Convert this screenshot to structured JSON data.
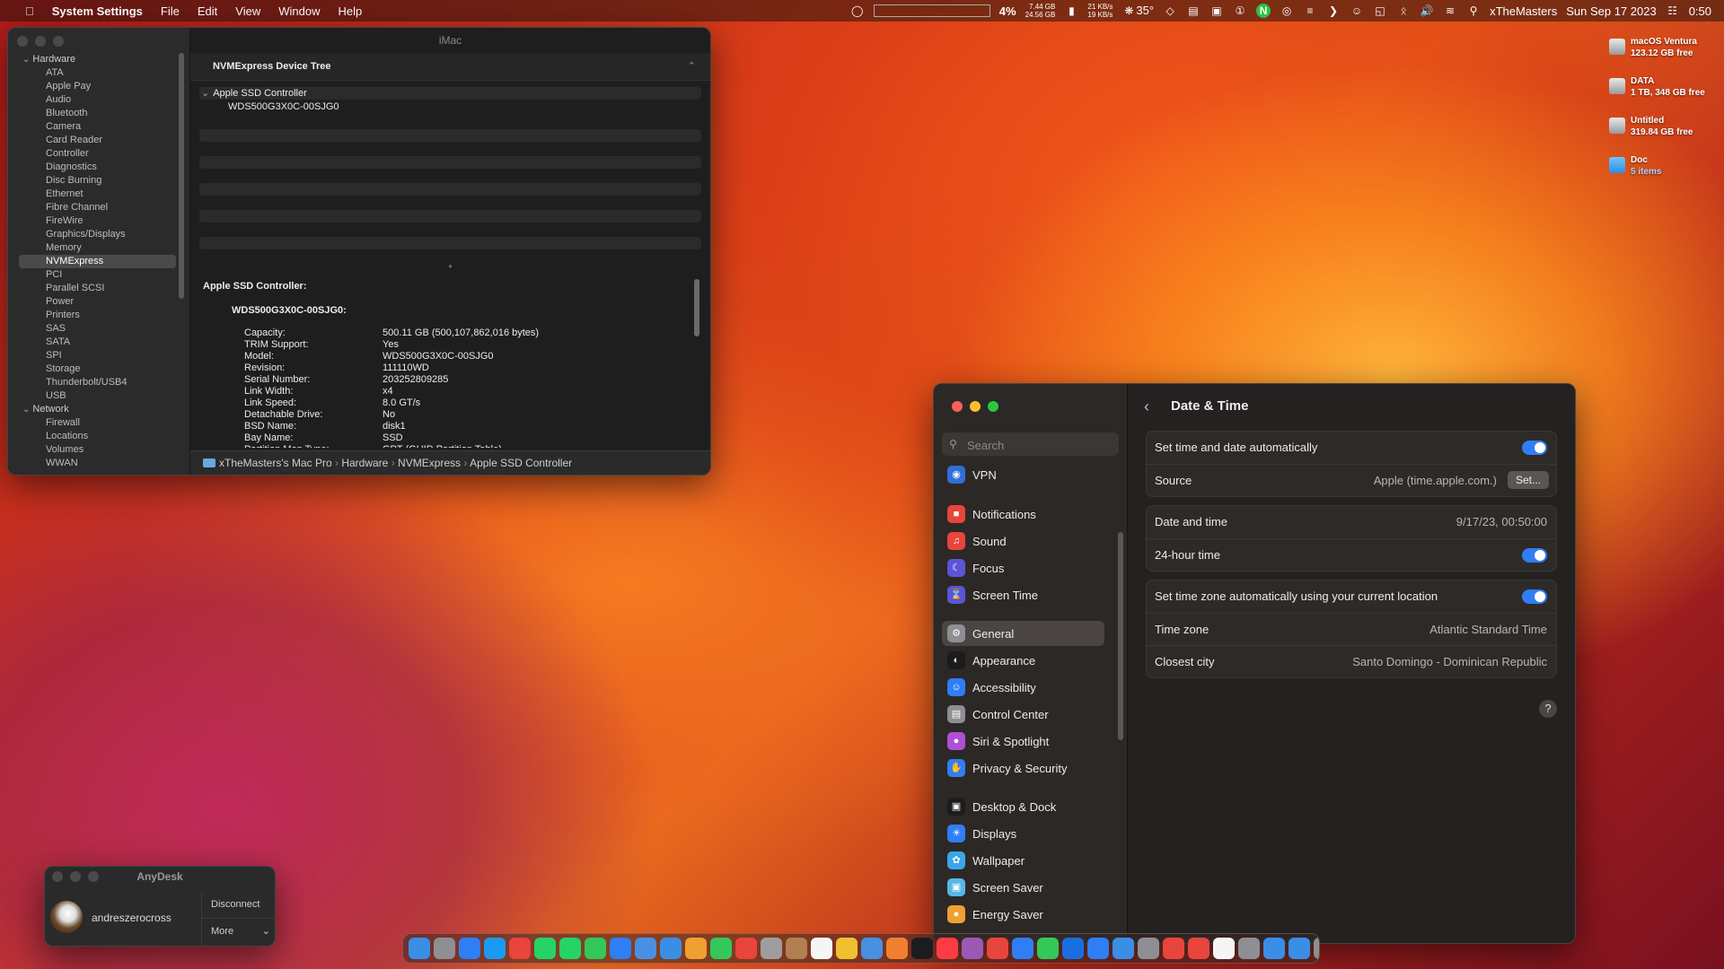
{
  "menubar": {
    "app": "System Settings",
    "menus": [
      "File",
      "Edit",
      "View",
      "Window",
      "Help"
    ],
    "cpu_percent": "4%",
    "mem_u": "7.44 GB",
    "mem_f": "24.56 GB",
    "net_up": "21 KB/s",
    "net_down": "19 KB/s",
    "temp": "35°",
    "user": "xTheMasters",
    "date": "Sun Sep 17 2023",
    "time": "0:50"
  },
  "desktop_icons": [
    {
      "name": "macOS Ventura",
      "sub": "123.12 GB free"
    },
    {
      "name": "DATA",
      "sub": "1 TB, 348 GB free"
    },
    {
      "name": "Untitled",
      "sub": "319.84 GB free"
    },
    {
      "name": "Doc",
      "sub": "5 items"
    }
  ],
  "sysinfo": {
    "window_title": "iMac",
    "sidebar_groups": [
      {
        "label": "Hardware",
        "items": [
          "ATA",
          "Apple Pay",
          "Audio",
          "Bluetooth",
          "Camera",
          "Card Reader",
          "Controller",
          "Diagnostics",
          "Disc Burning",
          "Ethernet",
          "Fibre Channel",
          "FireWire",
          "Graphics/Displays",
          "Memory",
          "NVMExpress",
          "PCI",
          "Parallel SCSI",
          "Power",
          "Printers",
          "SAS",
          "SATA",
          "SPI",
          "Storage",
          "Thunderbolt/USB4",
          "USB"
        ]
      },
      {
        "label": "Network",
        "items": [
          "Firewall",
          "Locations",
          "Volumes",
          "WWAN"
        ]
      }
    ],
    "selected": "NVMExpress",
    "tree_header": "NVMExpress Device Tree",
    "tree_rows": [
      "Apple SSD Controller",
      "WDS500G3X0C-00SJG0"
    ],
    "detail_title": "Apple SSD Controller:",
    "detail_device": "WDS500G3X0C-00SJG0:",
    "detail_rows": [
      {
        "label": "Capacity:",
        "value": "500.11 GB (500,107,862,016 bytes)"
      },
      {
        "label": "TRIM Support:",
        "value": "Yes"
      },
      {
        "label": "Model:",
        "value": "WDS500G3X0C-00SJG0"
      },
      {
        "label": "Revision:",
        "value": "111110WD"
      },
      {
        "label": "Serial Number:",
        "value": "203252809285"
      },
      {
        "label": "Link Width:",
        "value": "x4"
      },
      {
        "label": "Link Speed:",
        "value": "8.0 GT/s"
      },
      {
        "label": "Detachable Drive:",
        "value": "No"
      },
      {
        "label": "BSD Name:",
        "value": "disk1"
      },
      {
        "label": "Bay Name:",
        "value": "SSD"
      },
      {
        "label": "Partition Map Type:",
        "value": "GPT (GUID Partition Table)"
      }
    ],
    "breadcrumb": [
      "xTheMasters's Mac Pro",
      "Hardware",
      "NVMExpress",
      "Apple SSD Controller"
    ]
  },
  "settings": {
    "search_placeholder": "Search",
    "sidebar": [
      {
        "label": "VPN",
        "color": "#2f6fd8",
        "icon": "vpn-icon"
      },
      {
        "label": "Notifications",
        "color": "#e8453c",
        "icon": "bell-icon"
      },
      {
        "label": "Sound",
        "color": "#e8453c",
        "icon": "speaker-icon"
      },
      {
        "label": "Focus",
        "color": "#5b55d6",
        "icon": "moon-icon"
      },
      {
        "label": "Screen Time",
        "color": "#5b55d6",
        "icon": "hourglass-icon"
      },
      {
        "label": "General",
        "color": "#8e8e93",
        "icon": "gear-icon"
      },
      {
        "label": "Appearance",
        "color": "#1c1c1e",
        "icon": "appearance-icon"
      },
      {
        "label": "Accessibility",
        "color": "#2f7ef5",
        "icon": "accessibility-icon"
      },
      {
        "label": "Control Center",
        "color": "#8e8e93",
        "icon": "control-center-icon"
      },
      {
        "label": "Siri & Spotlight",
        "color": "#b04fd6",
        "icon": "siri-icon"
      },
      {
        "label": "Privacy & Security",
        "color": "#2f7ef5",
        "icon": "hand-icon"
      },
      {
        "label": "Desktop & Dock",
        "color": "#1c1c1e",
        "icon": "dock-icon"
      },
      {
        "label": "Displays",
        "color": "#2f7ef5",
        "icon": "sun-icon"
      },
      {
        "label": "Wallpaper",
        "color": "#3aa6e8",
        "icon": "flower-icon"
      },
      {
        "label": "Screen Saver",
        "color": "#56b8e8",
        "icon": "screensaver-icon"
      },
      {
        "label": "Energy Saver",
        "color": "#f0a030",
        "icon": "bulb-icon"
      }
    ],
    "selected": "General",
    "page_title": "Date & Time",
    "set_auto_label": "Set time and date automatically",
    "source_label": "Source",
    "source_value": "Apple (time.apple.com.)",
    "set_button": "Set...",
    "date_time_label": "Date and time",
    "date_time_value": "9/17/23, 00:50:00",
    "hour24_label": "24-hour time",
    "tz_auto_label": "Set time zone automatically using your current location",
    "tz_label": "Time zone",
    "tz_value": "Atlantic Standard Time",
    "city_label": "Closest city",
    "city_value": "Santo Domingo - Dominican Republic",
    "help": "?"
  },
  "anydesk": {
    "title": "AnyDesk",
    "user": "andreszerocross",
    "disconnect": "Disconnect",
    "more": "More"
  },
  "dock_colors": [
    "#3a8ee6",
    "#8e8e93",
    "#2f7ef5",
    "#1a9af0",
    "#e8453c",
    "#25d366",
    "#25d366",
    "#34c759",
    "#2f7ef5",
    "#4a90e2",
    "#3a8ee6",
    "#f0a030",
    "#34c759",
    "#e8453c",
    "#9e9e9e",
    "#b08050",
    "#f5f5f5",
    "#f0c030",
    "#4a90e2",
    "#f08030",
    "#1c1c1e",
    "#fc3c44",
    "#9b59b6",
    "#e8453c",
    "#2f7ef5",
    "#34c759",
    "#1a6fe0",
    "#2f7ef5",
    "#3a8ee6",
    "#8e8e93",
    "#e8453c",
    "#e8453c",
    "#f5f5f5",
    "#8e8e93",
    "#3a8ee6",
    "#3a8ee6",
    "#8e8e93"
  ]
}
